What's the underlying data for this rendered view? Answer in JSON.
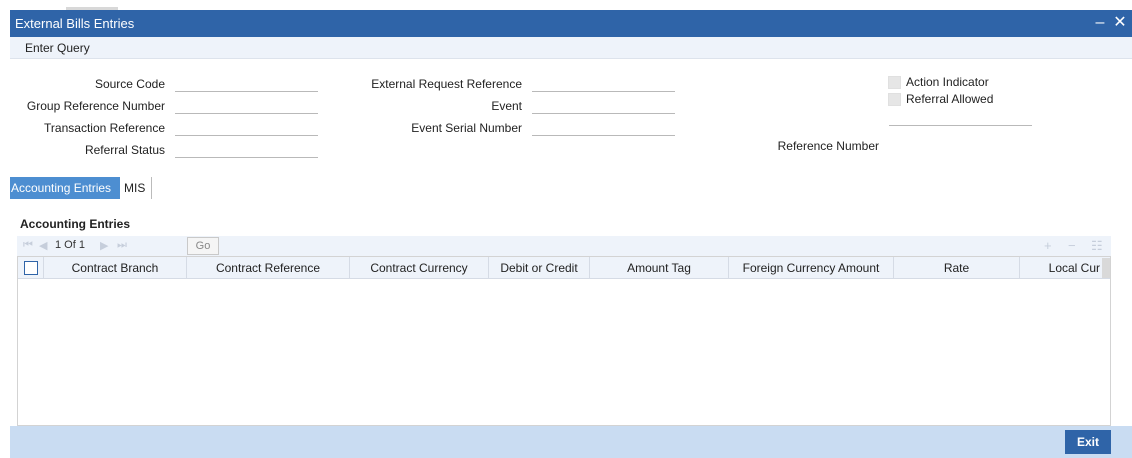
{
  "window": {
    "title": "External Bills Entries",
    "minimize_label": "–",
    "close_label": "✕"
  },
  "menu": {
    "enter_query": "Enter Query"
  },
  "form": {
    "source_code_label": "Source Code",
    "group_reference_number_label": "Group Reference Number",
    "transaction_reference_label": "Transaction Reference",
    "referral_status_label": "Referral Status",
    "external_request_reference_label": "External Request Reference",
    "event_label": "Event",
    "event_serial_number_label": "Event Serial Number",
    "action_indicator_label": "Action Indicator",
    "referral_allowed_label": "Referral Allowed",
    "reference_number_label": "Reference Number"
  },
  "tabs": {
    "accounting_entries": "Accounting Entries",
    "mis": "MIS"
  },
  "section": {
    "title": "Accounting Entries"
  },
  "pager": {
    "text": "1 Of 1",
    "go_label": "Go",
    "add_icon": "+",
    "remove_icon": "−",
    "view_icon": "☷"
  },
  "grid": {
    "columns": [
      "Contract Branch",
      "Contract Reference",
      "Contract Currency",
      "Debit or Credit",
      "Amount Tag",
      "Foreign Currency Amount",
      "Rate",
      "Local Cur"
    ],
    "rows": []
  },
  "footer": {
    "exit_label": "Exit"
  }
}
